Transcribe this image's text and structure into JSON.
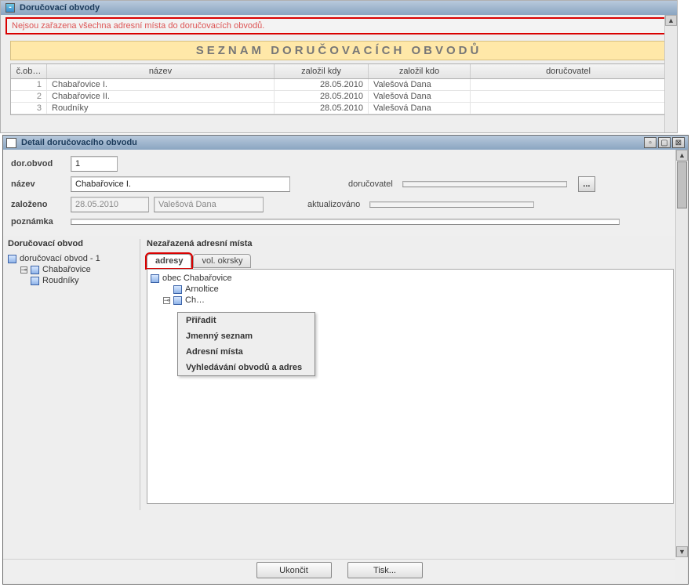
{
  "bg": {
    "title": "Doručovací obvody",
    "warning": "Nejsou zařazena všechna adresní místa do doručovacích obvodů.",
    "panel_title": "SEZNAM DORUČOVACÍCH OBVODŮ",
    "columns": {
      "num": "č.ob…",
      "name": "název",
      "date": "založil kdy",
      "who": "založil kdo",
      "del": "doručovatel"
    },
    "rows": [
      {
        "num": "1",
        "name": "Chabařovice I.",
        "date": "28.05.2010",
        "who": "Valešová Dana",
        "del": ""
      },
      {
        "num": "2",
        "name": "Chabařovice II.",
        "date": "28.05.2010",
        "who": "Valešová Dana",
        "del": ""
      },
      {
        "num": "3",
        "name": "Roudníky",
        "date": "28.05.2010",
        "who": "Valešová Dana",
        "del": ""
      }
    ]
  },
  "fg": {
    "title": "Detail doručovacího obvodu",
    "labels": {
      "dor_obvod": "dor.obvod",
      "nazev": "název",
      "dorucovatel": "doručovatel",
      "zalozeno": "založeno",
      "aktualizovano": "aktualizováno",
      "poznamka": "poznámka"
    },
    "values": {
      "dor_obvod": "1",
      "nazev": "Chabařovice I.",
      "zalozeno_date": "28.05.2010",
      "zalozeno_who": "Valešová Dana",
      "dorucovatel": "",
      "aktualizovano": "",
      "poznamka": ""
    },
    "left_title": "Doručovací obvod",
    "left_tree": {
      "root": "doručovací obvod - 1",
      "children": [
        "Chabařovice",
        "Roudníky"
      ]
    },
    "right_title": "Nezařazená adresní místa",
    "tabs": {
      "t1": "adresy",
      "t2": "vol. okrsky"
    },
    "right_tree": {
      "root": "obec Chabařovice",
      "children": [
        "Arnoltice",
        "Ch…"
      ]
    },
    "context": {
      "m1": "Přiřadit",
      "m2": "Jmenný seznam",
      "m3": "Adresní místa",
      "m4": "Vyhledávání obvodů a adres"
    },
    "buttons": {
      "close": "Ukončit",
      "print": "Tisk..."
    },
    "ellipsis": "..."
  }
}
